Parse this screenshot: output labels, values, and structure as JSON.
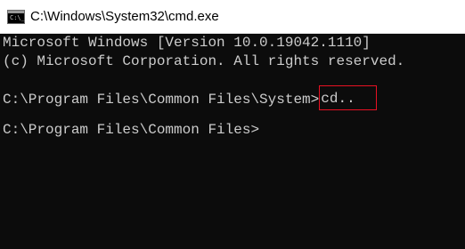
{
  "window": {
    "title": "C:\\Windows\\System32\\cmd.exe",
    "icon_name": "command-prompt-icon",
    "icon_glyph": "C:\\_"
  },
  "console": {
    "lines": [
      "Microsoft Windows [Version 10.0.19042.1110]",
      "(c) Microsoft Corporation. All rights reserved."
    ],
    "command_prompt": "C:\\Program Files\\Common Files\\System>",
    "command_input": "cd..",
    "result_prompt": "C:\\Program Files\\Common Files>"
  },
  "colors": {
    "background": "#0c0c0c",
    "text": "#cccccc",
    "highlight_border": "#e81123",
    "titlebar": "#ffffff"
  }
}
